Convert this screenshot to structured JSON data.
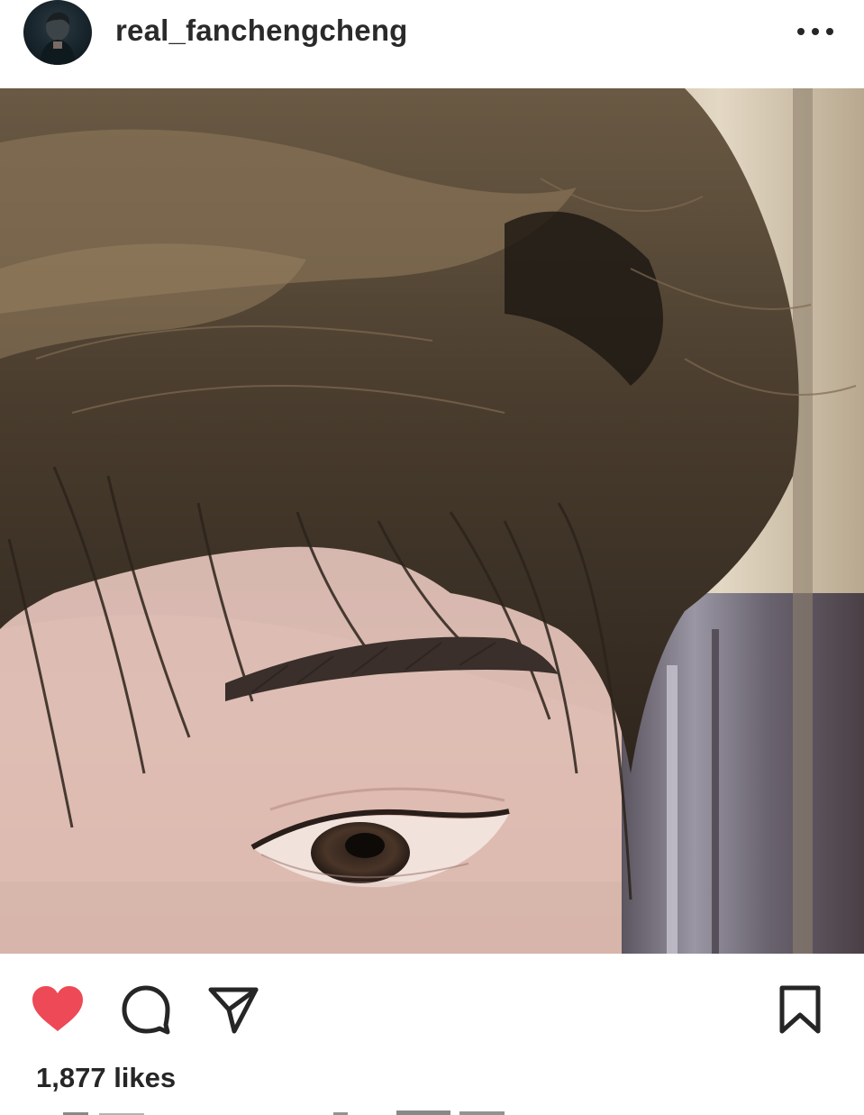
{
  "post": {
    "username": "real_fanchengcheng",
    "likes_text": "1,877 likes"
  },
  "icons": {
    "avatar": "profile-photo",
    "more": "more-options-icon",
    "like": "heart-filled-icon",
    "comment": "comment-bubble-icon",
    "share": "paper-plane-icon",
    "save": "bookmark-icon"
  },
  "colors": {
    "like_red": "#ed4956",
    "icon_dark": "#262626",
    "background": "#ffffff"
  }
}
